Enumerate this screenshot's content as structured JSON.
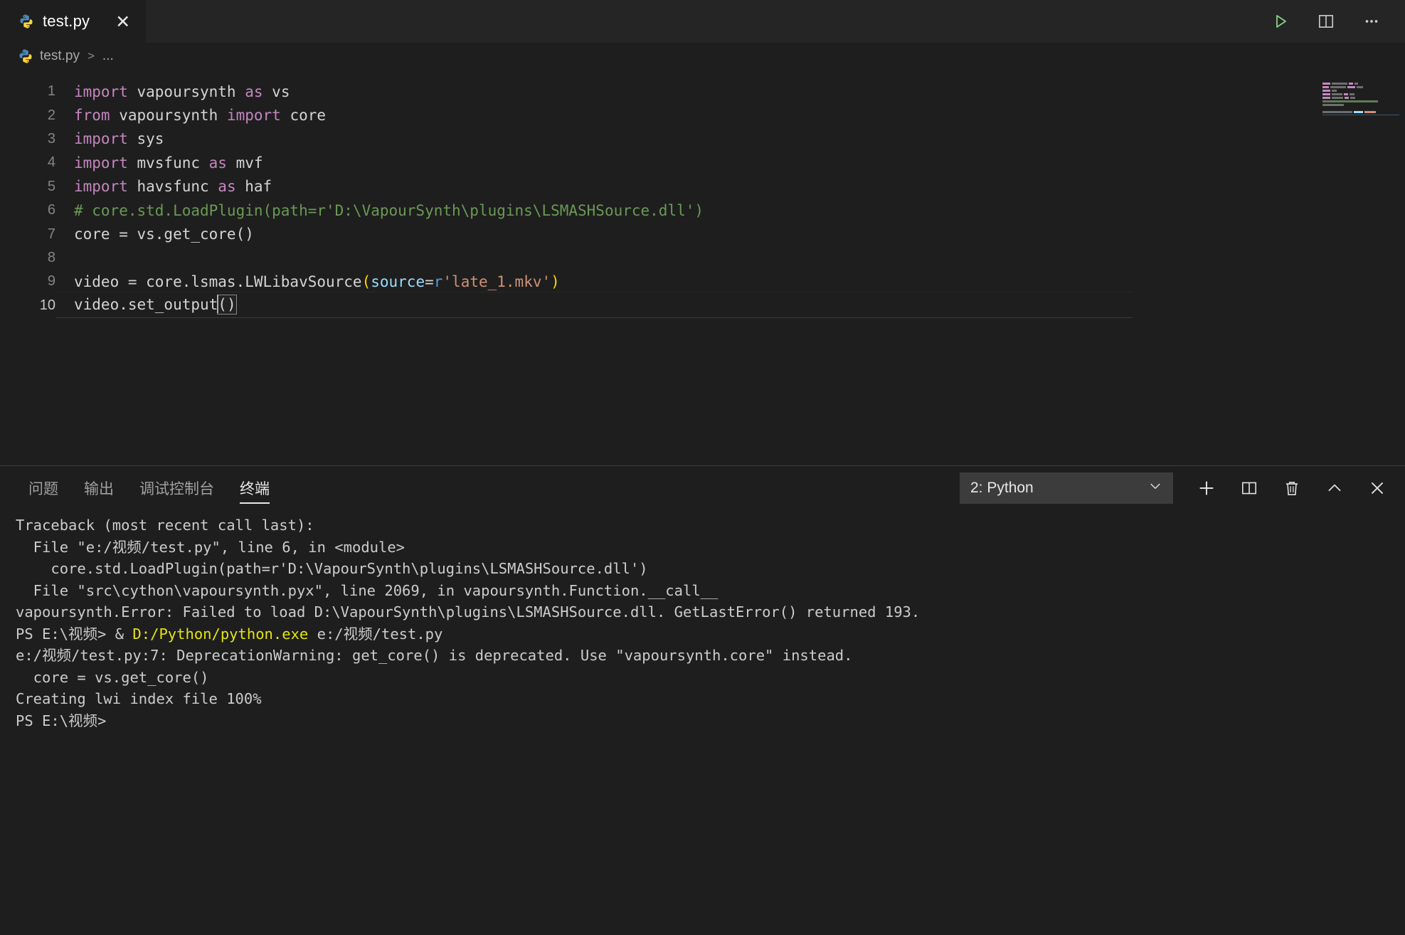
{
  "window": {
    "tab": {
      "label": "test.py",
      "icon": "python-icon",
      "close_icon": "close-icon"
    },
    "actions": [
      {
        "name": "run-python-file-button",
        "icon": "play-icon",
        "color": "#89d185"
      },
      {
        "name": "split-editor-button",
        "icon": "split-editor-icon"
      },
      {
        "name": "more-actions-button",
        "icon": "ellipsis-icon"
      }
    ]
  },
  "breadcrumb": {
    "file": "test.py",
    "separator": ">",
    "rest": "..."
  },
  "editor": {
    "language": "python",
    "cursor_line": 10,
    "lines": [
      {
        "n": "1",
        "tokens": [
          {
            "t": "import",
            "c": "kw"
          },
          {
            "t": " vapoursynth ",
            "c": "id"
          },
          {
            "t": "as",
            "c": "kw"
          },
          {
            "t": " vs",
            "c": "id"
          }
        ]
      },
      {
        "n": "2",
        "tokens": [
          {
            "t": "from",
            "c": "kw"
          },
          {
            "t": " vapoursynth ",
            "c": "id"
          },
          {
            "t": "import",
            "c": "kw"
          },
          {
            "t": " core",
            "c": "id"
          }
        ]
      },
      {
        "n": "3",
        "tokens": [
          {
            "t": "import",
            "c": "kw"
          },
          {
            "t": " sys",
            "c": "id"
          }
        ]
      },
      {
        "n": "4",
        "tokens": [
          {
            "t": "import",
            "c": "kw"
          },
          {
            "t": " mvsfunc ",
            "c": "id"
          },
          {
            "t": "as",
            "c": "kw"
          },
          {
            "t": " mvf",
            "c": "id"
          }
        ]
      },
      {
        "n": "5",
        "tokens": [
          {
            "t": "import",
            "c": "kw"
          },
          {
            "t": " havsfunc ",
            "c": "id"
          },
          {
            "t": "as",
            "c": "kw"
          },
          {
            "t": " haf",
            "c": "id"
          }
        ]
      },
      {
        "n": "6",
        "tokens": [
          {
            "t": "# core.std.LoadPlugin(path=r'D:\\VapourSynth\\plugins\\LSMASHSource.dll')",
            "c": "cmt"
          }
        ]
      },
      {
        "n": "7",
        "tokens": [
          {
            "t": "core = vs.get_core()",
            "c": "id"
          }
        ]
      },
      {
        "n": "8",
        "tokens": [
          {
            "t": "",
            "c": "id"
          }
        ]
      },
      {
        "n": "9",
        "tokens": [
          {
            "t": "video = core.lsmas.LWLibavSource",
            "c": "id"
          },
          {
            "t": "(",
            "c": "parenY"
          },
          {
            "t": "source",
            "c": "param"
          },
          {
            "t": "=",
            "c": "id"
          },
          {
            "t": "r",
            "c": "strp"
          },
          {
            "t": "'late_1.mkv'",
            "c": "str"
          },
          {
            "t": ")",
            "c": "parenY"
          }
        ]
      },
      {
        "n": "10",
        "tokens": [
          {
            "t": "video.set_output",
            "c": "id"
          }
        ],
        "caret": true,
        "bracket": "()"
      }
    ]
  },
  "panel": {
    "tabs": [
      {
        "label": "问题",
        "name": "tab-problems",
        "active": false
      },
      {
        "label": "输出",
        "name": "tab-output",
        "active": false
      },
      {
        "label": "调试控制台",
        "name": "tab-debug-console",
        "active": false
      },
      {
        "label": "终端",
        "name": "tab-terminal",
        "active": true
      }
    ],
    "terminal_selector": {
      "value": "2: Python",
      "chevron": "chevron-down-icon"
    },
    "actions": [
      {
        "name": "new-terminal-button",
        "icon": "plus-icon"
      },
      {
        "name": "split-terminal-button",
        "icon": "split-icon"
      },
      {
        "name": "kill-terminal-button",
        "icon": "trash-icon"
      },
      {
        "name": "collapse-panel-button",
        "icon": "chevron-up-icon"
      },
      {
        "name": "close-panel-button",
        "icon": "close-icon"
      }
    ]
  },
  "terminal": {
    "lines": [
      {
        "segments": [
          {
            "text": "Traceback (most recent call last):"
          }
        ]
      },
      {
        "segments": [
          {
            "text": "  File \"e:/视频/test.py\", line 6, in <module>"
          }
        ]
      },
      {
        "segments": [
          {
            "text": "    core.std.LoadPlugin(path=r'D:\\VapourSynth\\plugins\\LSMASHSource.dll')"
          }
        ]
      },
      {
        "segments": [
          {
            "text": "  File \"src\\cython\\vapoursynth.pyx\", line 2069, in vapoursynth.Function.__call__"
          }
        ]
      },
      {
        "segments": [
          {
            "text": "vapoursynth.Error: Failed to load D:\\VapourSynth\\plugins\\LSMASHSource.dll. GetLastError() returned 193."
          }
        ]
      },
      {
        "segments": [
          {
            "text": "PS E:\\视频> & "
          },
          {
            "text": "D:/Python/python.exe",
            "color": "yellow"
          },
          {
            "text": " e:/视频/test.py"
          }
        ]
      },
      {
        "segments": [
          {
            "text": "e:/视频/test.py:7: DeprecationWarning: get_core() is deprecated. Use \"vapoursynth.core\" instead."
          }
        ]
      },
      {
        "segments": [
          {
            "text": "  core = vs.get_core()"
          }
        ]
      },
      {
        "segments": [
          {
            "text": "Creating lwi index file 100%"
          }
        ]
      },
      {
        "segments": [
          {
            "text": "PS E:\\视频>"
          }
        ]
      }
    ]
  },
  "colors": {
    "editor_background": "#1e1e1e",
    "tabbar_background": "#252526",
    "keyword": "#c586c0",
    "comment": "#6a9955",
    "string": "#ce9178",
    "parameter": "#9cdcfe",
    "run_green": "#89d185",
    "terminal_yellow": "#e5e510"
  }
}
